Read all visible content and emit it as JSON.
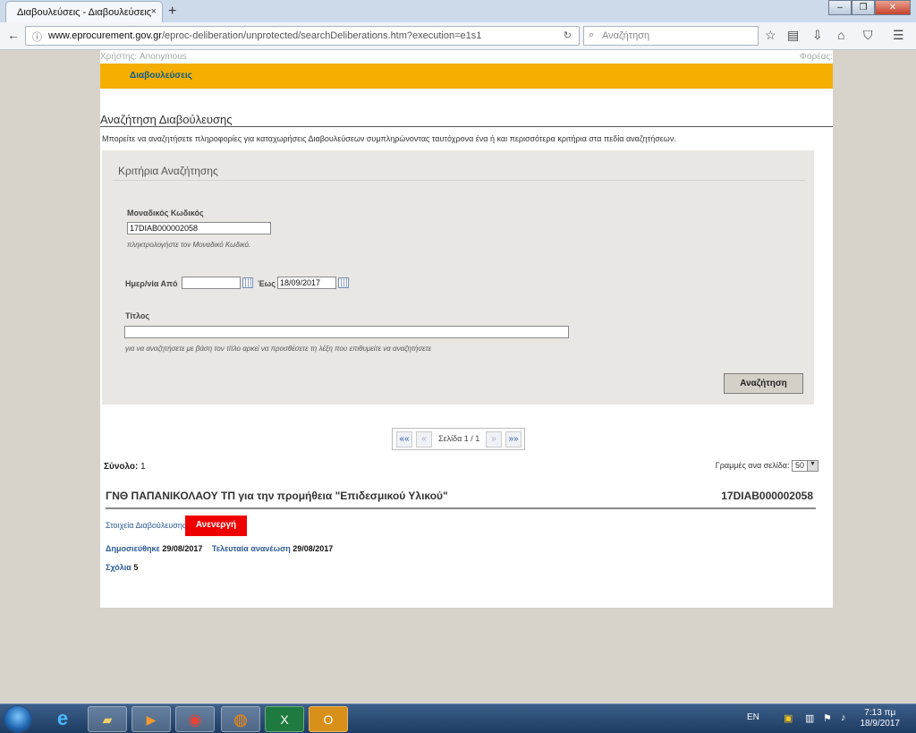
{
  "browser": {
    "tab_title": "Διαβουλεύσεις - Διαβουλεύσεις",
    "tab_close": "×",
    "new_tab": "+",
    "url_domain": "www.eprocurement.gov.gr",
    "url_path": "/eproc-deliberation/unprotected/searchDeliberations.htm?execution=e1s1",
    "search_placeholder": "Αναζήτηση",
    "window_controls": [
      "–",
      "❐",
      "✕"
    ]
  },
  "header": {
    "user": "Χρήστης: Anonymous",
    "org": "Φορέας:",
    "menu_item": "Διαβουλεύσεις"
  },
  "main": {
    "title": "Αναζήτηση Διαβούλευσης",
    "intro": "Μπορείτε να αναζητήσετε πληροφορίες για καταχωρήσεις Διαβουλεύσεων συμπληρώνοντας ταυτόχρονα ένα ή και περισσότερα κριτήρια στα πεδία αναζητήσεων.",
    "panel_title": "Κριτήρια Αναζήτησης",
    "code_label": "Μοναδικός Κωδικός",
    "code_value": "17DIAB000002058",
    "code_hint": "πληκτρολογήστε τον Μοναδικό Κωδικό.",
    "date_from_label": "Ημερ/νία Από",
    "date_from_value": "",
    "date_to_label": "Έως",
    "date_to_value": "18/09/2017",
    "title_label": "Τίτλος",
    "title_value": "",
    "title_hint": "για να αναζητήσετε με βάση τον τίτλο αρκεί να προσθέσετε τη λέξη που επιθυμείτε να αναζητήσετε",
    "search_button": "Αναζήτηση"
  },
  "pager": {
    "first": "««",
    "prev": "«",
    "label": "Σελίδα 1 / 1",
    "next": "»",
    "last": "»»"
  },
  "results": {
    "total_label": "Σύνολο:",
    "total_value": "1",
    "rows_label": "Γραμμές ανα σελίδα:",
    "rows_value": "50",
    "item": {
      "title": "ΓΝΘ ΠΑΠΑΝΙΚΟΛΑΟΥ ΤΠ για την προμήθεια \"Επιδεσμικού Υλικού\"",
      "code": "17DIAB000002058",
      "details_link": "Στοιχεία Διαβούλευσης",
      "status": "Ανενεργή",
      "published_label": "Δημοσιεύθηκε",
      "published_value": "29/08/2017",
      "updated_label": "Τελευταία ανανέωση",
      "updated_value": "29/08/2017",
      "comments_label": "Σχόλια",
      "comments_value": "5"
    }
  },
  "taskbar": {
    "apps": [
      "internet-explorer",
      "file-explorer",
      "media-player",
      "chrome",
      "firefox",
      "excel",
      "outlook"
    ],
    "lang": "EN",
    "time": "7:13 πμ",
    "date": "18/9/2017"
  },
  "colors": {
    "menu_bar": "#f3ae00",
    "status_inactive": "#ef0000",
    "link": "#2c5a99"
  }
}
